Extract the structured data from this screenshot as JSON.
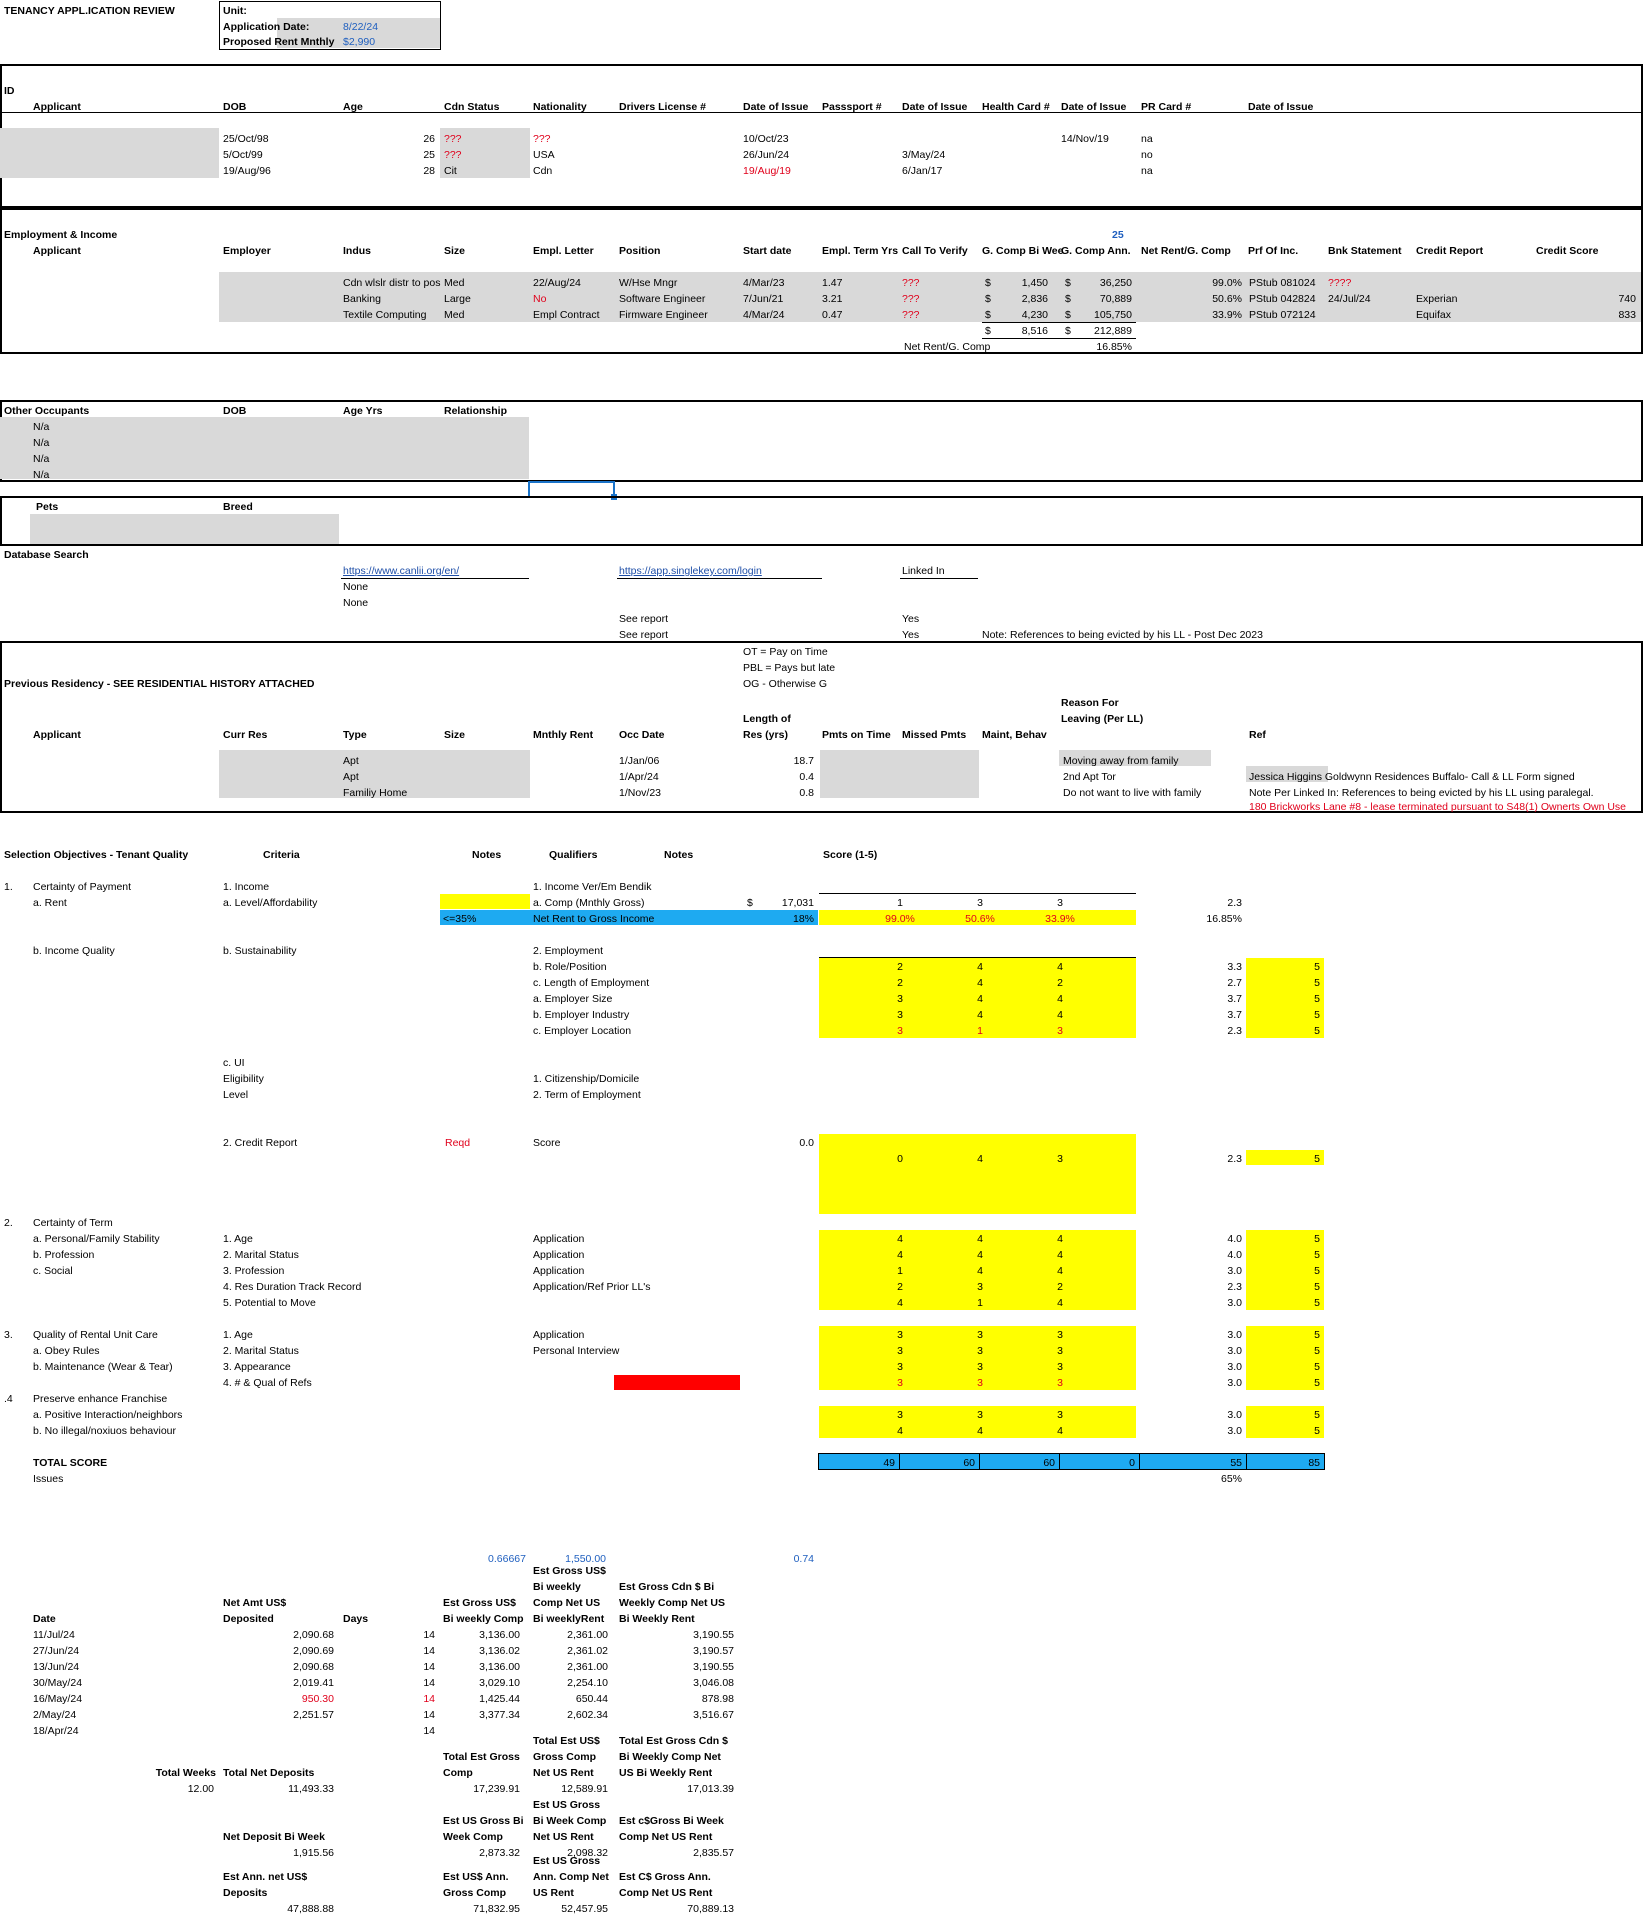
{
  "header": {
    "title": "TENANCY APPL.ICATION REVIEW",
    "unit_label": "Unit:",
    "app_date_label": "Application Date:",
    "app_date": "8/22/24",
    "rent_label": "Proposed Rent Mnthly",
    "rent": "$2,990"
  },
  "id_section": {
    "section_label": "ID",
    "headers": [
      "Applicant",
      "DOB",
      "Age",
      "Cdn Status",
      "Nationality",
      "Drivers License #",
      "Date of Issue",
      "Passsport #",
      "Date of Issue",
      "Health Card #",
      "Date of Issue",
      "PR Card #",
      "Date of Issue"
    ],
    "rows": [
      {
        "dob": "25/Oct/98",
        "age": "26",
        "status": "???",
        "nationality": "???",
        "dl_issue": "10/Oct/23",
        "pass_issue": "",
        "health_issue": "14/Nov/19",
        "pr": "na"
      },
      {
        "dob": "5/Oct/99",
        "age": "25",
        "status": "???",
        "nationality": "USA",
        "dl_issue": "26/Jun/24",
        "pass_issue": "3/May/24",
        "health_issue": "",
        "pr": "no"
      },
      {
        "dob": "19/Aug/96",
        "age": "28",
        "status": "Cit",
        "nationality": "Cdn",
        "dl_issue": "19/Aug/19",
        "pass_issue": "6/Jan/17",
        "health_issue": "",
        "pr": "na"
      }
    ]
  },
  "employment": {
    "section_label": "Employment & Income",
    "top_value": "25",
    "headers": [
      "Applicant",
      "Employer",
      "Indus",
      "Size",
      "Empl. Letter",
      "Position",
      "Start date",
      "Empl. Term Yrs",
      "Call To Verify",
      "G. Comp Bi Wee",
      "G. Comp Ann.",
      "Net Rent/G. Comp",
      "Prf Of Inc.",
      "Bnk Statement",
      "Credit Report",
      "Credit Score"
    ],
    "rows": [
      {
        "indus": "Cdn wlslr distr to pos",
        "size": "Med",
        "letter": "22/Aug/24",
        "position": "W/Hse Mngr",
        "start": "4/Mar/23",
        "term": "1.47",
        "call": "???",
        "cur1": "$",
        "biweek": "1,450",
        "cur2": "$",
        "annual": "36,250",
        "ratio": "99.0%",
        "proof": "PStub 081024",
        "bank": "????",
        "credit": "",
        "score": ""
      },
      {
        "indus": "Banking",
        "size": "Large",
        "letter": "No",
        "position": "Software Engineer",
        "start": "7/Jun/21",
        "term": "3.21",
        "call": "???",
        "cur1": "$",
        "biweek": "2,836",
        "cur2": "$",
        "annual": "70,889",
        "ratio": "50.6%",
        "proof": "PStub 042824",
        "bank": "24/Jul/24",
        "credit": "Experian",
        "score": "740"
      },
      {
        "indus": "Textile Computing",
        "size": "Med",
        "letter": "Empl Contract",
        "position": "Firmware Engineer",
        "start": "4/Mar/24",
        "term": "0.47",
        "call": "???",
        "cur1": "$",
        "biweek": "4,230",
        "cur2": "$",
        "annual": "105,750",
        "ratio": "33.9%",
        "proof": "PStub 072124",
        "bank": "",
        "credit": "Equifax",
        "score": "833"
      }
    ],
    "total_cur1": "$",
    "total_biweek": "8,516",
    "total_cur2": "$",
    "total_annual": "212,889",
    "net_label": "Net Rent/G. Comp",
    "net_value": "16.85%"
  },
  "occupants": {
    "section_label": "Other Occupants",
    "headers": [
      "DOB",
      "Age Yrs",
      "Relationship"
    ],
    "rows": [
      "N/a",
      "N/a",
      "N/a",
      "N/a"
    ]
  },
  "pets": {
    "label": "Pets",
    "breed": "Breed"
  },
  "database": {
    "label": "Database Search",
    "link1": "https://www.canlii.org/en/",
    "link1_r1": "None",
    "link1_r2": "None",
    "link2": "https://app.singlekey.com/login",
    "link2_r1": "See report",
    "link2_r2": "See report",
    "link3": "Linked In",
    "link3_r1": "Yes",
    "link3_r2": "Yes",
    "note": "Note: References to being evicted by his LL - Post Dec 2023"
  },
  "residency": {
    "legend": [
      "OT = Pay on Time",
      "PBL = Pays but late",
      "OG - Otherwise G"
    ],
    "title": "Previous Residency - SEE RESIDENTIAL HISTORY ATTACHED",
    "headers": [
      "Applicant",
      "Curr Res",
      "Type",
      "Size",
      "Mnthly Rent",
      "Occ Date",
      "Length of Res (yrs)",
      "Pmts on Time",
      "Missed Pmts",
      "Maint, Behav",
      "Reason For Leaving (Per LL)",
      "Ref"
    ],
    "rows": [
      {
        "type": "Apt",
        "occ": "1/Jan/06",
        "len": "18.7",
        "reason": "Moving away from family",
        "ref": ""
      },
      {
        "type": "Apt",
        "occ": "1/Apr/24",
        "len": "0.4",
        "reason": "2nd Apt Tor",
        "ref": "Jessica Higgins Goldwynn Residences Buffalo- Call & LL Form signed"
      },
      {
        "type": "Familiy Home",
        "occ": "1/Nov/23",
        "len": "0.8",
        "reason": "Do not want to live with family",
        "ref": "Note Per Linked In: References to being evicted by his LL using paralegal."
      }
    ],
    "ref_red": "180 Brickworks Lane #8 - lease terminated pursuant to S48(1) Ownerts Own Use"
  },
  "selection": {
    "headers": {
      "objectives": "Selection Objectives - Tenant Quality",
      "criteria": "Criteria",
      "notes1": "Notes",
      "qualifiers": "Qualifiers",
      "notes2": "Notes",
      "score": "Score (1-5)"
    },
    "cert_payment": {
      "num": "1.",
      "title": "Certainty of Payment",
      "rent": "a. Rent",
      "income_quality": "b. Income Quality",
      "c_income": "1. Income",
      "c_level": "a. Level/Affordability",
      "c_sust": "b. Sustainability",
      "le35": "<=35%",
      "q_income": "1. Income Ver/Em Bendik",
      "q_comp": "a. Comp (Mnthly Gross)",
      "q_net": "Net Rent to Gross Income",
      "comp_cur": "$",
      "comp_val": "17,031",
      "net_val": "18%",
      "comp_scores": [
        "1",
        "3",
        "3"
      ],
      "comp_avg": "2.3",
      "net_scores": [
        "99.0%",
        "50.6%",
        "33.9%"
      ],
      "net_avg": "16.85%"
    },
    "employment_rows": [
      {
        "q": "2. Employment",
        "s": [
          "",
          "",
          ""
        ],
        "avg": "",
        "max": ""
      },
      {
        "q": "b. Role/Position",
        "s": [
          "2",
          "4",
          "4"
        ],
        "avg": "3.3",
        "max": "5"
      },
      {
        "q": "c. Length of Employment",
        "s": [
          "2",
          "4",
          "2"
        ],
        "avg": "2.7",
        "max": "5"
      },
      {
        "q": "a. Employer Size",
        "s": [
          "3",
          "4",
          "4"
        ],
        "avg": "3.7",
        "max": "5"
      },
      {
        "q": "b. Employer Industry",
        "s": [
          "3",
          "4",
          "4"
        ],
        "avg": "3.7",
        "max": "5"
      },
      {
        "q": "c. Employer Location",
        "s": [
          "3",
          "1",
          "3"
        ],
        "avg": "2.3",
        "max": "5"
      }
    ],
    "ui": {
      "c1": "c. UI",
      "c2": "Eligibility",
      "c3": "Level",
      "q1": "1. Citizenship/Domicile",
      "q2": "2. Term of Employment"
    },
    "credit": {
      "c": "2. Credit Report",
      "notes": "Reqd",
      "q": "Score",
      "val": "0.0",
      "s": [
        "0",
        "4",
        "3"
      ],
      "avg": "2.3",
      "max": "5"
    },
    "cert_term": {
      "num": "2.",
      "title": "Certainty of Term",
      "rows": [
        {
          "obj": "a. Personal/Family Stability",
          "crit": "1. Age",
          "q": "Application",
          "s": [
            "4",
            "4",
            "4"
          ],
          "avg": "4.0",
          "max": "5"
        },
        {
          "obj": "b. Profession",
          "crit": "2. Marital Status",
          "q": "Application",
          "s": [
            "4",
            "4",
            "4"
          ],
          "avg": "4.0",
          "max": "5"
        },
        {
          "obj": "c. Social",
          "crit": "3. Profession",
          "q": "Application",
          "s": [
            "1",
            "4",
            "4"
          ],
          "avg": "3.0",
          "max": "5"
        },
        {
          "obj": "",
          "crit": "4. Res Duration Track Record",
          "q": "Application/Ref Prior LL's",
          "s": [
            "2",
            "3",
            "2"
          ],
          "avg": "2.3",
          "max": "5"
        },
        {
          "obj": "",
          "crit": "5. Potential to Move",
          "q": "",
          "s": [
            "4",
            "1",
            "4"
          ],
          "avg": "3.0",
          "max": "5"
        }
      ]
    },
    "quality": {
      "num": "3.",
      "title": "Quality of Rental Unit Care",
      "rows": [
        {
          "obj": "",
          "crit": "1. Age",
          "q": "Application",
          "s": [
            "3",
            "3",
            "3"
          ],
          "avg": "3.0",
          "max": "5"
        },
        {
          "obj": "a. Obey Rules",
          "crit": "2. Marital Status",
          "q": "Personal Interview",
          "s": [
            "3",
            "3",
            "3"
          ],
          "avg": "3.0",
          "max": "5"
        },
        {
          "obj": "b. Maintenance (Wear & Tear)",
          "crit": "3. Appearance",
          "q": "",
          "s": [
            "3",
            "3",
            "3"
          ],
          "avg": "3.0",
          "max": "5"
        },
        {
          "obj": "",
          "crit": "4. # & Qual of Refs",
          "q": "",
          "s": [
            "3",
            "3",
            "3"
          ],
          "avg": "3.0",
          "max": "5"
        }
      ]
    },
    "franchise": {
      "num": ".4",
      "title": "Preserve enhance Franchise",
      "rows": [
        {
          "obj": "a. Positive Interaction/neighbors",
          "s": [
            "3",
            "3",
            "3"
          ],
          "avg": "3.0",
          "max": "5"
        },
        {
          "obj": "b. No illegal/noxiuos behaviour",
          "s": [
            "4",
            "4",
            "4"
          ],
          "avg": "3.0",
          "max": "5"
        }
      ]
    },
    "total": {
      "label": "TOTAL SCORE",
      "issues": "Issues",
      "vals": [
        "49",
        "60",
        "60",
        "0",
        "55",
        "85"
      ],
      "pct": "65%"
    }
  },
  "deposits": {
    "top": [
      "0.66667",
      "1,550.00",
      "0.74"
    ],
    "headers": {
      "date": "Date",
      "net": "Net Amt US$ Deposited",
      "days": "Days",
      "gross": "Est Gross US$ Bi weekly Comp",
      "grossnet": "Est Gross US$ Bi weekly Comp Net US Bi weeklyRent",
      "cdn": "Est Gross Cdn $ Bi Weekly Comp Net US Bi Weekly Rent"
    },
    "rows": [
      {
        "date": "11/Jul/24",
        "net": "2,090.68",
        "days": "14",
        "gross": "3,136.00",
        "gn": "2,361.00",
        "cdn": "3,190.55",
        "red": false
      },
      {
        "date": "27/Jun/24",
        "net": "2,090.69",
        "days": "14",
        "gross": "3,136.02",
        "gn": "2,361.02",
        "cdn": "3,190.57",
        "red": false
      },
      {
        "date": "13/Jun/24",
        "net": "2,090.68",
        "days": "14",
        "gross": "3,136.00",
        "gn": "2,361.00",
        "cdn": "3,190.55",
        "red": false
      },
      {
        "date": "30/May/24",
        "net": "2,019.41",
        "days": "14",
        "gross": "3,029.10",
        "gn": "2,254.10",
        "cdn": "3,046.08",
        "red": false
      },
      {
        "date": "16/May/24",
        "net": "950.30",
        "days": "14",
        "gross": "1,425.44",
        "gn": "650.44",
        "cdn": "878.98",
        "red": true
      },
      {
        "date": "2/May/24",
        "net": "2,251.57",
        "days": "14",
        "gross": "3,377.34",
        "gn": "2,602.34",
        "cdn": "3,516.67",
        "red": false
      },
      {
        "date": "18/Apr/24",
        "net": "",
        "days": "14",
        "gross": "",
        "gn": "",
        "cdn": "",
        "red": false
      }
    ],
    "totals": {
      "weeks_label": "Total Weeks",
      "weeks": "12.00",
      "dep_label": "Total Net Deposits",
      "dep": "11,493.33",
      "gross_label": "Total Est Gross Comp",
      "gross": "17,239.91",
      "gn_label": "Total Est US$ Gross Comp Net US Rent",
      "gn": "12,589.91",
      "cdn_label": "Total Est Gross Cdn $ Bi Weekly Comp Net US Bi Weekly Rent",
      "cdn": "17,013.39"
    },
    "biweek": {
      "dep_label": "Net Deposit Bi Week",
      "dep": "1,915.56",
      "gross_label": "Est US Gross Bi Week Comp",
      "gross": "2,873.32",
      "gn_label": "Est US Gross Bi Week Comp Net US Rent",
      "gn": "2,098.32",
      "cdn_label": "Est c$Gross Bi Week Comp Net US Rent",
      "cdn": "2,835.57"
    },
    "annual": {
      "dep_label": "Est Ann. net US$ Deposits",
      "dep": "47,888.88",
      "gross_label": "Est US$ Ann. Gross Comp",
      "gross": "71,832.95",
      "gn_label": "Est US Gross Ann. Comp Net US Rent",
      "gn": "52,457.95",
      "cdn_label": "Est C$ Gross Ann. Comp Net US Rent",
      "cdn": "70,889.13"
    }
  }
}
